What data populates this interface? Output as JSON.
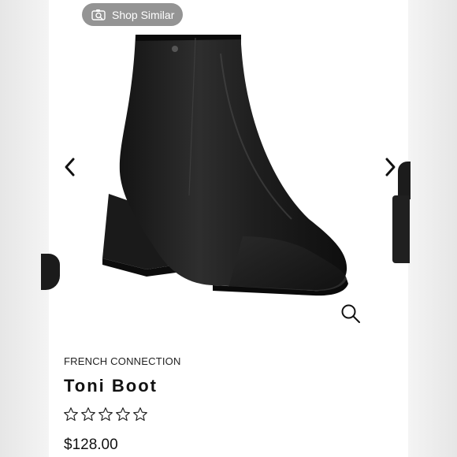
{
  "shop_similar": {
    "label": "Shop Similar",
    "icon": "camera-search-icon"
  },
  "gallery": {
    "prev_icon": "chevron-left-icon",
    "next_icon": "chevron-right-icon",
    "zoom_icon": "magnifier-icon",
    "image_subject": "black leather ankle boot"
  },
  "product": {
    "brand": "FRENCH CONNECTION",
    "name": "Toni Boot",
    "rating": 0,
    "rating_max": 5,
    "price": "$128.00"
  }
}
